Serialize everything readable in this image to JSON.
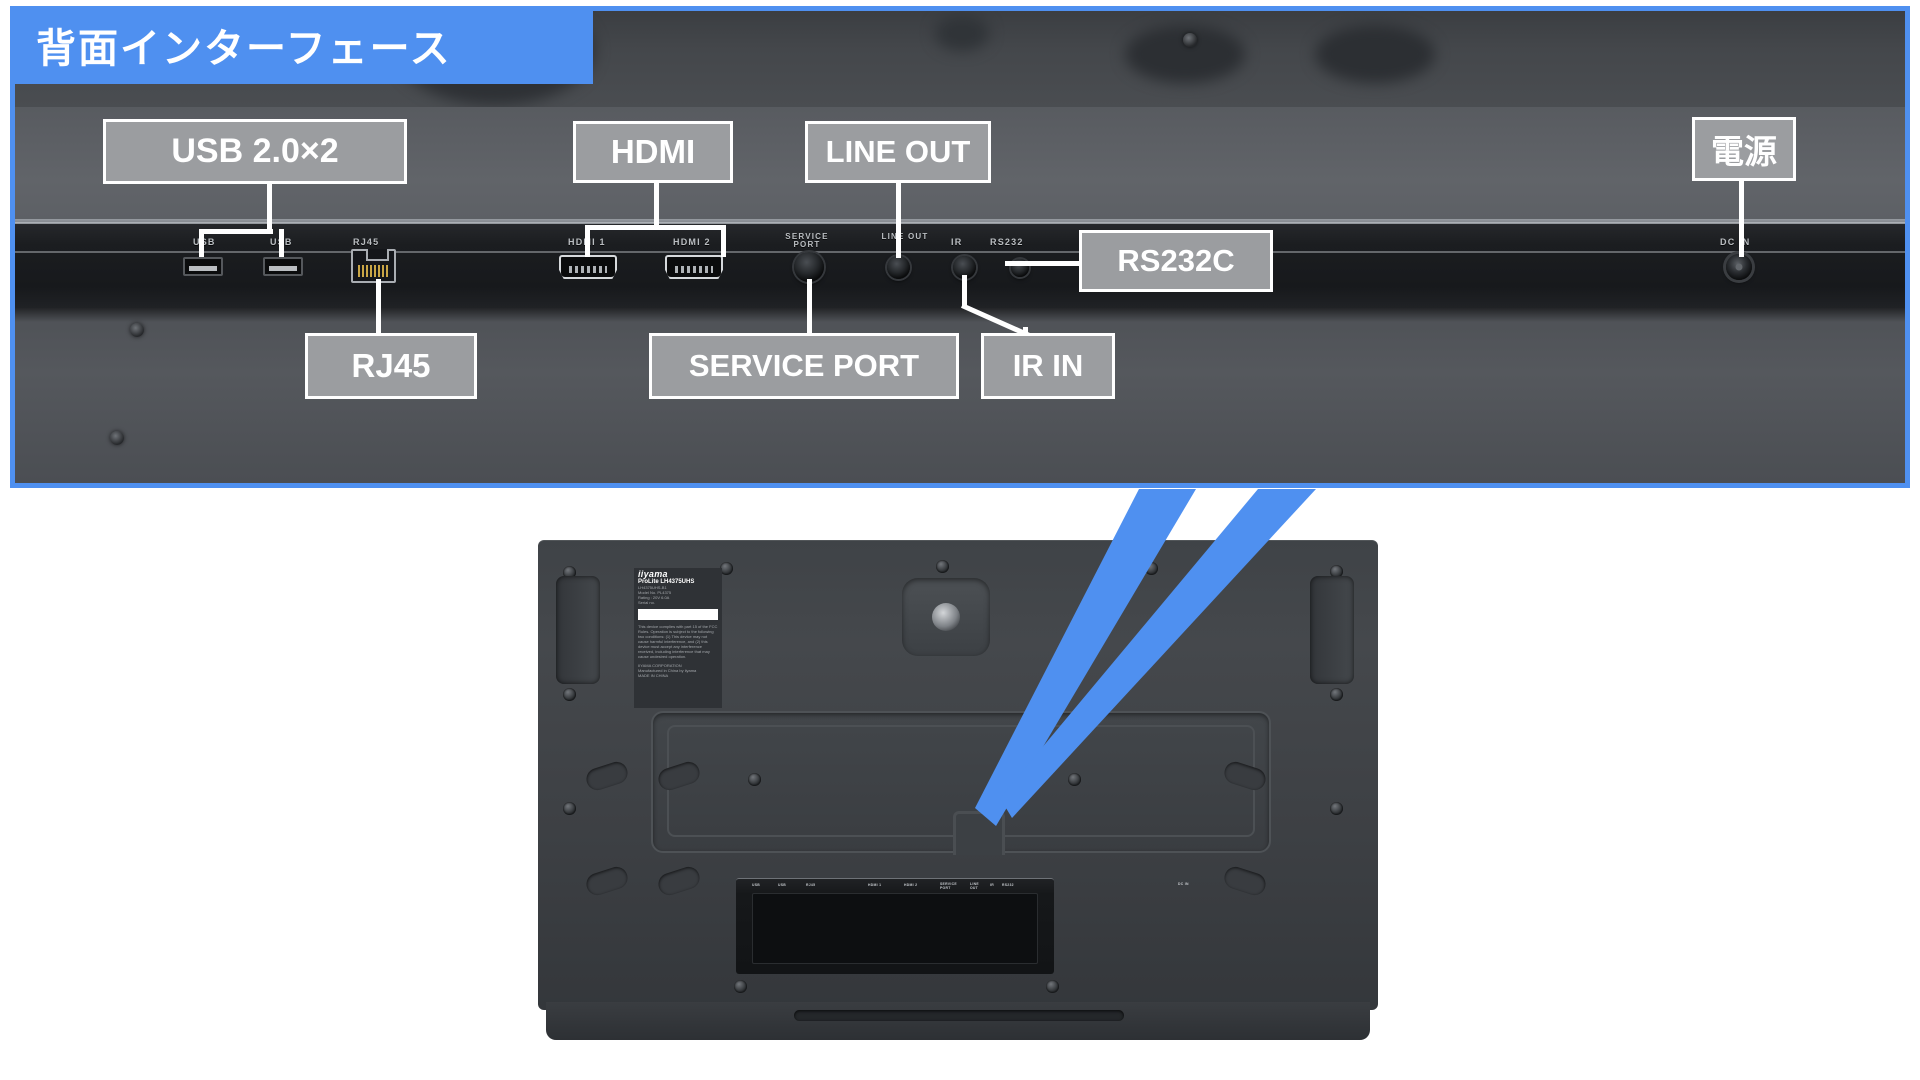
{
  "header": {
    "title": "背面インターフェース",
    "accent_color": "#4f90f0"
  },
  "callouts": [
    {
      "id": "usb",
      "label": "USB 2.0×2",
      "row": "top"
    },
    {
      "id": "hdmi",
      "label": "HDMI",
      "row": "top"
    },
    {
      "id": "line-out",
      "label": "LINE OUT",
      "row": "top"
    },
    {
      "id": "power",
      "label": "電源",
      "row": "top"
    },
    {
      "id": "rs232c",
      "label": "RS232C",
      "row": "mid"
    },
    {
      "id": "rj45",
      "label": "RJ45",
      "row": "bottom"
    },
    {
      "id": "service-port",
      "label": "SERVICE PORT",
      "row": "bottom"
    },
    {
      "id": "ir-in",
      "label": "IR IN",
      "row": "bottom"
    }
  ],
  "panel_silkscreen": [
    {
      "id": "usb1",
      "text": "USB"
    },
    {
      "id": "usb2",
      "text": "USB"
    },
    {
      "id": "rj45",
      "text": "RJ45"
    },
    {
      "id": "hdmi1",
      "text": "HDMI 1"
    },
    {
      "id": "hdmi2",
      "text": "HDMI 2"
    },
    {
      "id": "service",
      "text": "SERVICE PORT"
    },
    {
      "id": "lineout",
      "text": "LINE OUT"
    },
    {
      "id": "ir",
      "text": "IR"
    },
    {
      "id": "rs232",
      "text": "RS232"
    },
    {
      "id": "dcin",
      "text": "DC IN"
    }
  ],
  "product_label": {
    "brand": "iiyama",
    "line1": "ProLite LH4375UHS",
    "line2": "LH4375UHS-B1",
    "line3": "Model No. PL4375",
    "line4": "Rating : 20V 6.0A",
    "line5": "Serial no.",
    "fine_block": "This device complies with part 15 of the FCC Rules. Operation is subject to the following two conditions: (1) This device may not cause harmful interference, and (2) this device must accept any interference received, including interference that may cause undesired operation.",
    "company": "IIYAMA CORPORATION",
    "company_addr": "Manufactured in China by iiyama",
    "origin": "MADE IN CHINA"
  },
  "product_io_silkscreen": [
    "USB",
    "USB",
    "RJ45",
    "HDMI 1",
    "HDMI 2",
    "SERVICE PORT",
    "LINE OUT",
    "IR",
    "RS232",
    "DC IN"
  ],
  "colors": {
    "callout_bg": "#9b9da0",
    "callout_border": "#ffffff",
    "callout_text": "#ffffff",
    "frame_blue": "#4f90f0",
    "page_bg": "#ffffff"
  }
}
